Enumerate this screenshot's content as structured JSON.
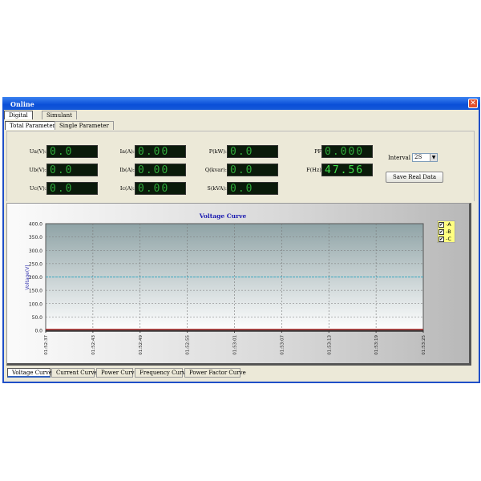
{
  "window": {
    "title": "Online",
    "close": "✕"
  },
  "top_tabs": [
    "Digital",
    "Simulant"
  ],
  "sub_tabs": [
    "Total Parameter",
    "Single Parameter"
  ],
  "readings": [
    {
      "label": "Ua(V):",
      "value": "0.0"
    },
    {
      "label": "Ub(V):",
      "value": "0.0"
    },
    {
      "label": "Uc(V):",
      "value": "0.0"
    },
    {
      "label": "Ia(A):",
      "value": "0.00"
    },
    {
      "label": "Ib(A):",
      "value": "0.00"
    },
    {
      "label": "Ic(A):",
      "value": "0.00"
    },
    {
      "label": "P(kW):",
      "value": "0.0"
    },
    {
      "label": "Q(kvar):",
      "value": "0.0"
    },
    {
      "label": "S(kVA):",
      "value": "0.0"
    },
    {
      "label": "PF:",
      "value": "0.000"
    },
    {
      "label": "F(Hz):",
      "value": "47.56"
    }
  ],
  "interval": {
    "label": "Interval",
    "value": "2S",
    "arrow": "▼"
  },
  "save_button": "Save Real Data",
  "legend": {
    "items": [
      {
        "label": "A",
        "checked": true
      },
      {
        "label": "B",
        "checked": true
      },
      {
        "label": "C",
        "checked": true
      }
    ],
    "check": "✔"
  },
  "bottom_tabs": [
    "Voltage Curve",
    "Current Curve",
    "Power Curve",
    "Frequency Curve",
    "Power Factor Curve"
  ],
  "chart_data": {
    "type": "line",
    "title": "Voltage Curve",
    "ylabel": "Voltage(V)",
    "xlabel": "",
    "ylim": [
      0,
      400
    ],
    "yticks": [
      "400.0",
      "350.0",
      "300.0",
      "250.0",
      "200.0",
      "150.0",
      "100.0",
      "50.0",
      "0.0"
    ],
    "x": [
      "01:52:37",
      "01:52:43",
      "01:52:49",
      "01:52:55",
      "01:53:01",
      "01:53:07",
      "01:53:13",
      "01:53:19",
      "01:53:25"
    ],
    "series": [
      {
        "name": "A",
        "values": [
          0,
          0,
          0,
          0,
          0,
          0,
          0,
          0,
          0
        ],
        "color": "#a02020"
      }
    ],
    "reference_line": {
      "value": 200,
      "color": "#3aa6c0"
    },
    "grid": true,
    "legend": "right"
  }
}
